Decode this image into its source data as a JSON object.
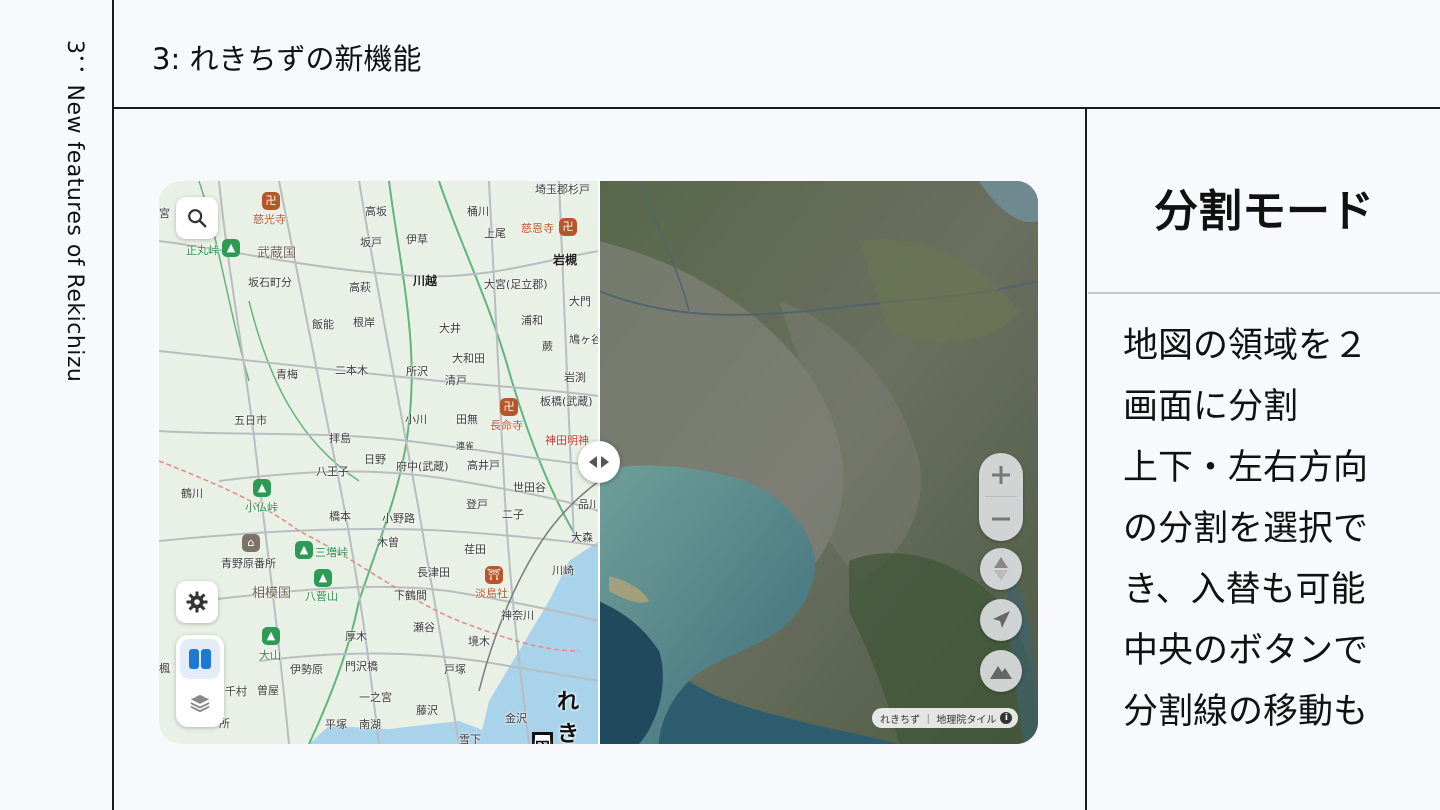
{
  "sidebar": {
    "label": "3： New features of Rekichizu"
  },
  "header": {
    "title": "3: れきちずの新機能"
  },
  "panel": {
    "title": "分割モード",
    "lines": [
      "地図の領域を２",
      "画面に分割",
      "上下・左右方向",
      "の分割を選択で",
      "き、入替も可能",
      "中央のボタンで",
      "分割線の移動も"
    ]
  },
  "map": {
    "logo_text": "れきちず",
    "logo_mark": "図",
    "attribution": "れきちず ｜ 地理院タイル",
    "info_icon_text": "i",
    "places": [
      {
        "t": "宮",
        "c": ""
      },
      {
        "t": "慈光寺",
        "c": "poi"
      },
      {
        "t": "高坂",
        "c": ""
      },
      {
        "t": "正丸峠",
        "c": "green"
      },
      {
        "t": "武蔵国",
        "c": "brown"
      },
      {
        "t": "坂戸",
        "c": ""
      },
      {
        "t": "伊草",
        "c": ""
      },
      {
        "t": "桶川",
        "c": ""
      },
      {
        "t": "上尾",
        "c": ""
      },
      {
        "t": "慈恩寺",
        "c": "poi"
      },
      {
        "t": "埼玉郡",
        "c": ""
      },
      {
        "t": "杉戸",
        "c": ""
      },
      {
        "t": "岩槻",
        "c": "bold"
      },
      {
        "t": "坂石町分",
        "c": ""
      },
      {
        "t": "高萩",
        "c": ""
      },
      {
        "t": "川越",
        "c": "bold"
      },
      {
        "t": "大宮(足立郡)",
        "c": ""
      },
      {
        "t": "大門",
        "c": ""
      },
      {
        "t": "飯能",
        "c": ""
      },
      {
        "t": "根岸",
        "c": ""
      },
      {
        "t": "大井",
        "c": ""
      },
      {
        "t": "浦和",
        "c": ""
      },
      {
        "t": "鳩ヶ谷",
        "c": ""
      },
      {
        "t": "蕨",
        "c": ""
      },
      {
        "t": "大和田",
        "c": ""
      },
      {
        "t": "二本木",
        "c": ""
      },
      {
        "t": "所沢",
        "c": ""
      },
      {
        "t": "青梅",
        "c": ""
      },
      {
        "t": "清戸",
        "c": ""
      },
      {
        "t": "岩渕",
        "c": ""
      },
      {
        "t": "板橋(武蔵)",
        "c": ""
      },
      {
        "t": "五日市",
        "c": ""
      },
      {
        "t": "小川",
        "c": ""
      },
      {
        "t": "田無",
        "c": ""
      },
      {
        "t": "長命寺",
        "c": "poi"
      },
      {
        "t": "拝島",
        "c": ""
      },
      {
        "t": "神田明神",
        "c": "red"
      },
      {
        "t": "連雀",
        "c": ""
      },
      {
        "t": "日野",
        "c": ""
      },
      {
        "t": "府中(武蔵)",
        "c": ""
      },
      {
        "t": "高井戸",
        "c": ""
      },
      {
        "t": "八王子",
        "c": ""
      },
      {
        "t": "世田谷",
        "c": ""
      },
      {
        "t": "鶴川",
        "c": ""
      },
      {
        "t": "小仏峠",
        "c": "green"
      },
      {
        "t": "登戸",
        "c": ""
      },
      {
        "t": "品川",
        "c": ""
      },
      {
        "t": "橋本",
        "c": ""
      },
      {
        "t": "小野路",
        "c": ""
      },
      {
        "t": "二子",
        "c": ""
      },
      {
        "t": "三増峠",
        "c": "green"
      },
      {
        "t": "木曽",
        "c": ""
      },
      {
        "t": "大森",
        "c": ""
      },
      {
        "t": "青野原番所",
        "c": ""
      },
      {
        "t": "荏田",
        "c": ""
      },
      {
        "t": "相模国",
        "c": "brown"
      },
      {
        "t": "八菅山",
        "c": "green"
      },
      {
        "t": "長津田",
        "c": ""
      },
      {
        "t": "淡島社",
        "c": "poi"
      },
      {
        "t": "川崎",
        "c": ""
      },
      {
        "t": "下鶴間",
        "c": ""
      },
      {
        "t": "神奈川",
        "c": ""
      },
      {
        "t": "瀬谷",
        "c": ""
      },
      {
        "t": "大山",
        "c": "green"
      },
      {
        "t": "厚木",
        "c": ""
      },
      {
        "t": "境木",
        "c": ""
      },
      {
        "t": "楓",
        "c": ""
      },
      {
        "t": "伊勢原",
        "c": ""
      },
      {
        "t": "門沢橋",
        "c": ""
      },
      {
        "t": "戸塚",
        "c": ""
      },
      {
        "t": "千村",
        "c": ""
      },
      {
        "t": "曽屋",
        "c": ""
      },
      {
        "t": "一之宮",
        "c": ""
      },
      {
        "t": "藤沢",
        "c": ""
      },
      {
        "t": "所",
        "c": ""
      },
      {
        "t": "平塚",
        "c": ""
      },
      {
        "t": "南湖",
        "c": ""
      },
      {
        "t": "金沢",
        "c": ""
      },
      {
        "t": "雪下",
        "c": ""
      }
    ]
  }
}
